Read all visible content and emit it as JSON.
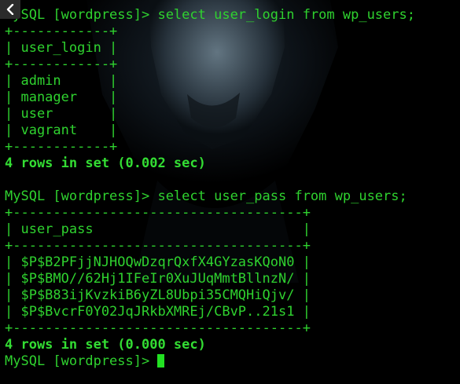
{
  "terminal": {
    "lines": [
      {
        "text": "MySQL [wordpress]> select user_login from wp_users;",
        "bold": false
      },
      {
        "text": "+------------+",
        "bold": false
      },
      {
        "text": "| user_login |",
        "bold": false
      },
      {
        "text": "+------------+",
        "bold": false
      },
      {
        "text": "| admin      |",
        "bold": false
      },
      {
        "text": "| manager    |",
        "bold": false
      },
      {
        "text": "| user       |",
        "bold": false
      },
      {
        "text": "| vagrant    |",
        "bold": false
      },
      {
        "text": "+------------+",
        "bold": false
      },
      {
        "text": "4 rows in set (0.002 sec)",
        "bold": true
      },
      {
        "text": "",
        "bold": false
      },
      {
        "text": "MySQL [wordpress]> select user_pass from wp_users;",
        "bold": false
      },
      {
        "text": "+------------------------------------+",
        "bold": false
      },
      {
        "text": "| user_pass                          |",
        "bold": false
      },
      {
        "text": "+------------------------------------+",
        "bold": false
      },
      {
        "text": "| $P$B2PFjjNJHOQwDzqrQxfX4GYzasKQoN0 |",
        "bold": false
      },
      {
        "text": "| $P$BMO//62Hj1IFeIr0XuJUqMmtBllnzN/ |",
        "bold": false
      },
      {
        "text": "| $P$B83ijKvzkiB6yZL8Ubpi35CMQHiQjv/ |",
        "bold": false
      },
      {
        "text": "| $P$BvcrF0Y02JqJRkbXMREj/CBvP..21s1 |",
        "bold": false
      },
      {
        "text": "+------------------------------------+",
        "bold": false
      },
      {
        "text": "4 rows in set (0.000 sec)",
        "bold": true
      },
      {
        "text": "",
        "bold": false
      }
    ],
    "prompt": "MySQL [wordpress]> "
  },
  "icons": {
    "back": "chevron-left-icon",
    "cursor": "block-cursor"
  },
  "colors": {
    "background": "#000000",
    "text": "#2fd22f",
    "cursor": "#22e022"
  }
}
